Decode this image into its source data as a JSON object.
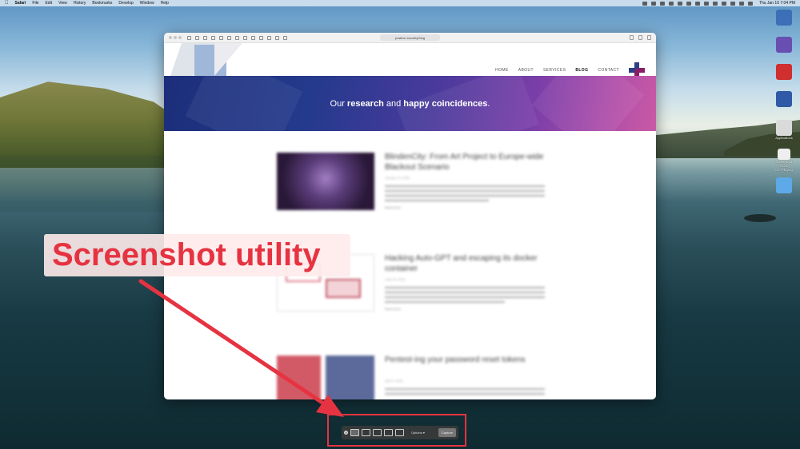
{
  "menubar": {
    "app": "Safari",
    "items": [
      "File",
      "Edit",
      "View",
      "History",
      "Bookmarks",
      "Develop",
      "Window",
      "Help"
    ],
    "clock": "Thu Jan 16 7:04 PM"
  },
  "desktop": {
    "icons": [
      {
        "name": "drive-icon",
        "label": "",
        "color": "#3d6fb6"
      },
      {
        "name": "drive-icon-2",
        "label": "",
        "color": "#6a4fb3"
      },
      {
        "name": "drive-icon-3",
        "label": "",
        "color": "#cf2f2f"
      },
      {
        "name": "drive-icon-4",
        "label": "",
        "color": "#2f5ba6"
      },
      {
        "name": "applications-icon",
        "label": "Applications",
        "color": "#dadada"
      },
      {
        "name": "screenshot-file-icon",
        "label": "Screenshot 2025-01...PM.png",
        "color": "#eeeeee"
      },
      {
        "name": "folder-icon",
        "label": "",
        "color": "#5ea9e8"
      }
    ]
  },
  "browser": {
    "url": "positive.security/blog",
    "nav": [
      "HOME",
      "ABOUT",
      "SERVICES",
      "BLOG",
      "CONTACT"
    ],
    "active_nav": "BLOG",
    "banner": {
      "pre": "Our ",
      "b1": "research",
      "mid": " and ",
      "b2": "happy coincidences",
      "end": "."
    },
    "posts": [
      {
        "title": "BlindenCity: From Art Project to Europe-wide Blackout Scenario",
        "date": "January 14, 2025",
        "more": "Read more"
      },
      {
        "title": "Hacking Auto-GPT and escaping its docker container",
        "date": "June 29, 2023",
        "more": "Read more"
      },
      {
        "title": "Pentest-ing your password reset tokens",
        "date": "April 4, 2023",
        "more": ""
      }
    ]
  },
  "annotation": {
    "label": "Screenshot utility",
    "color": "#e63341"
  },
  "screenshot_toolbar": {
    "options_label": "Options ▾",
    "capture_label": "Capture"
  }
}
